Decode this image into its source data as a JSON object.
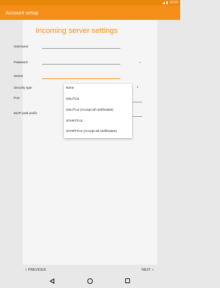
{
  "status_bar": {
    "time": "10:09"
  },
  "app_bar": {
    "title": "Account setup"
  },
  "form": {
    "heading": "Incoming server settings",
    "fields": {
      "username": {
        "label": "Username",
        "value": ""
      },
      "password": {
        "label": "Password",
        "value": ""
      },
      "server": {
        "label": "Server",
        "value": ""
      },
      "security_type": {
        "label": "Security type"
      },
      "port": {
        "label": "Port",
        "value": ""
      },
      "imap_path_prefix": {
        "label": "IMAP path prefix",
        "value": ""
      }
    }
  },
  "security_dropdown": {
    "options": [
      "None",
      "SSL/TLS",
      "SSL/TLS (Accept all certificates)",
      "STARTTLS",
      "STARTTLS (Accept all certificates)"
    ]
  },
  "footer": {
    "previous_label": "PREVIOUS",
    "next_label": "NEXT"
  },
  "icons": {
    "signal": "signal-icon",
    "battery": "battery-icon",
    "password_visibility": "eye-icon",
    "back": "back-icon",
    "home": "home-icon",
    "recents": "recents-icon"
  },
  "colors": {
    "accent": "#f58f1a",
    "status_bar": "#e8870a"
  }
}
